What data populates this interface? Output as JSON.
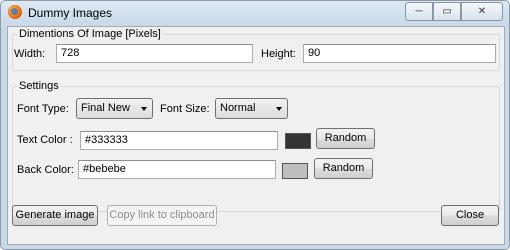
{
  "window": {
    "title": "Dummy Images",
    "controls": {
      "minimize": "─",
      "maximize": "▭",
      "close": "✕"
    }
  },
  "dimensions": {
    "legend": "Dimentions Of Image [Pixels]",
    "width_label": "Width:",
    "width_value": "728",
    "height_label": "Height:",
    "height_value": "90"
  },
  "settings": {
    "legend": "Settings",
    "font_type_label": "Font Type:",
    "font_type_value": "Final New",
    "font_size_label": "Font Size:",
    "font_size_value": "Normal",
    "text_color_label": "Text Color :",
    "text_color_value": "#333333",
    "text_color_swatch": "#333333",
    "back_color_label": "Back Color:",
    "back_color_value": "#bebebe",
    "back_color_swatch": "#bebebe",
    "random_label": "Random"
  },
  "footer": {
    "generate_label": "Generate image",
    "copy_label": "Copy link to clipboard",
    "close_label": "Close"
  }
}
